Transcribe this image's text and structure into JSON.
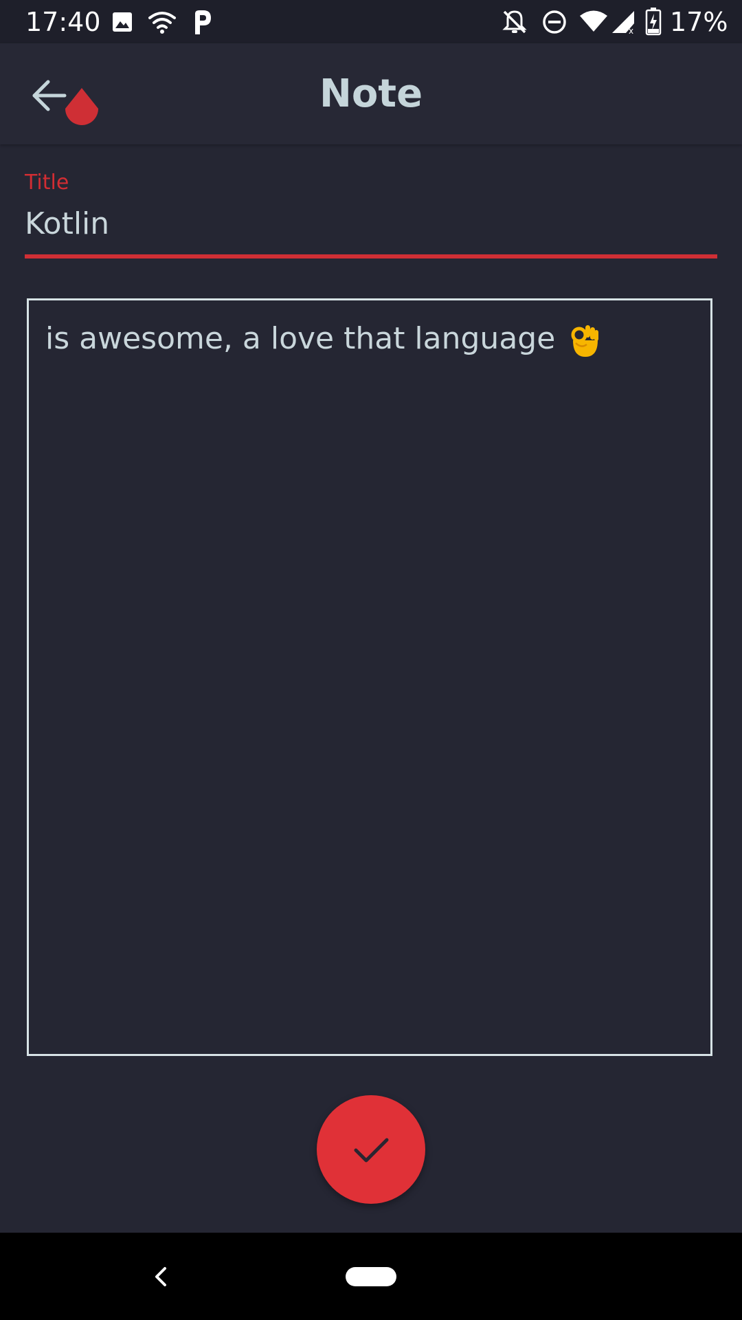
{
  "status_bar": {
    "time": "17:40",
    "battery_percent": "17%",
    "icons": [
      "image-icon",
      "wifi-icon",
      "parking-icon",
      "notifications-off-icon",
      "do-not-disturb-icon",
      "wifi-signal-icon",
      "cell-signal-icon",
      "battery-charging-icon"
    ]
  },
  "app_bar": {
    "title": "Note",
    "back_icon": "arrow-back-icon"
  },
  "title_field": {
    "label": "Title",
    "value": "Kotlin"
  },
  "note_body": {
    "text": "is awesome, a love that language",
    "emoji": "ok-hand-emoji"
  },
  "fab": {
    "icon": "check-icon"
  },
  "colors": {
    "background": "#252633",
    "app_bar": "#272835",
    "accent": "#e03137",
    "text": "#c9d6db",
    "title_text": "#c5d5da"
  }
}
